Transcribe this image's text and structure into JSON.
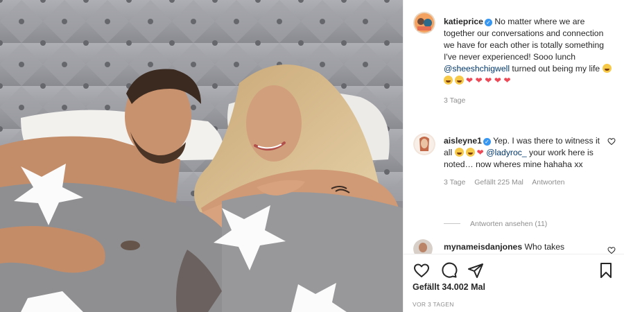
{
  "caption": {
    "username": "katieprice",
    "text": "No matter where we are together our conversations and connection we have for each other is totally something I've never experienced! Sooo lunch",
    "mention": "@sheeshchigwell",
    "text_after": "turned out being my life",
    "time": "3 Tage"
  },
  "comments": [
    {
      "username": "aisleyne1",
      "text": "Yep. I was there to witness it all",
      "mention": "@ladyroc_",
      "text_after": "your work here is noted… now wheres mine hahaha xx",
      "time": "3 Tage",
      "likes": "Gefällt 225 Mal",
      "reply": "Antworten",
      "view_replies": "Antworten ansehen (11)"
    },
    {
      "username": "mynameisdanjones",
      "text": "Who takes"
    }
  ],
  "footer": {
    "likes": "Gefällt 34.002 Mal",
    "ago": "VOR 3 TAGEN"
  },
  "icons": {
    "verified": "verified-badge-icon",
    "like": "heart-icon",
    "comment": "comment-bubble-icon",
    "share": "paper-plane-icon",
    "save": "bookmark-icon"
  },
  "colors": {
    "verified": "#3897f0",
    "link": "#00376b",
    "heart": "#ed4956",
    "muted": "#8e8e8e"
  }
}
